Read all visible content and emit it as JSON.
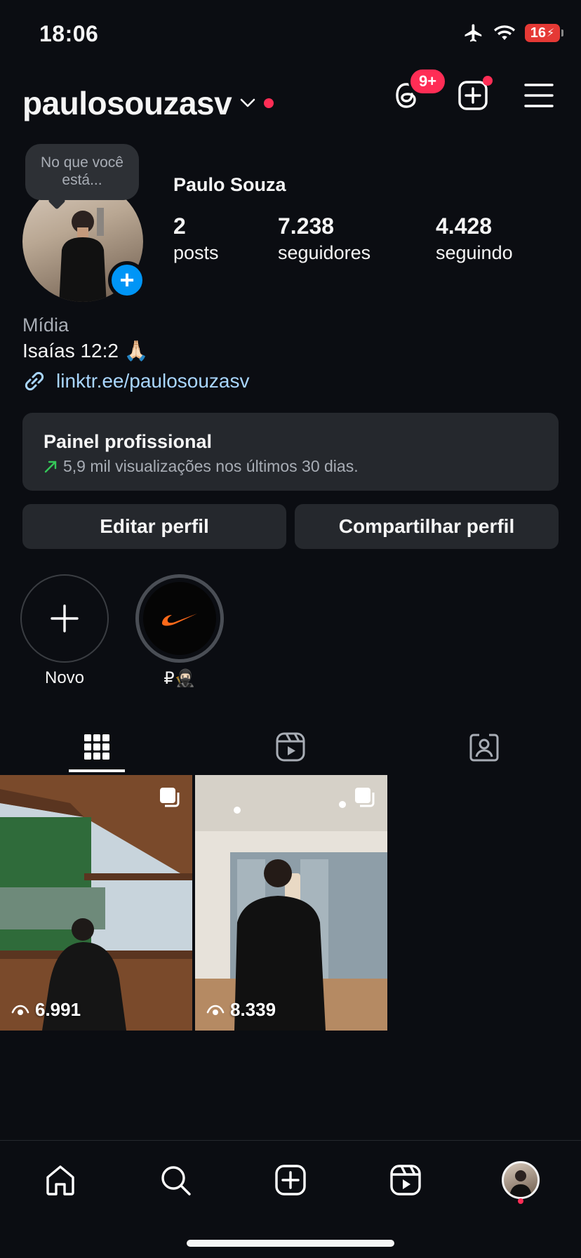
{
  "status_bar": {
    "time": "18:06",
    "battery": "16"
  },
  "header": {
    "username": "paulosouzasv",
    "threads_badge": "9+"
  },
  "profile": {
    "story_prompt": "No que você está...",
    "display_name": "Paulo Souza",
    "stats": [
      {
        "value": "2",
        "label": "posts"
      },
      {
        "value": "7.238",
        "label": "seguidores"
      },
      {
        "value": "4.428",
        "label": "seguindo"
      }
    ],
    "category": "Mídia",
    "bio": "Isaías 12:2 🙏🏻",
    "link": "linktr.ee/paulosouzasv"
  },
  "dashboard": {
    "title": "Painel profissional",
    "subtitle": "5,9 mil visualizações nos últimos 30 dias."
  },
  "buttons": {
    "edit": "Editar perfil",
    "share": "Compartilhar perfil"
  },
  "highlights": [
    {
      "label": "Novo"
    },
    {
      "label": "₽🥷🏻"
    }
  ],
  "posts": [
    {
      "views": "6.991"
    },
    {
      "views": "8.339"
    }
  ],
  "colors": {
    "accent": "#0095f6",
    "notification": "#ff2d55",
    "background": "#0b0d12",
    "surface": "#25282d"
  }
}
